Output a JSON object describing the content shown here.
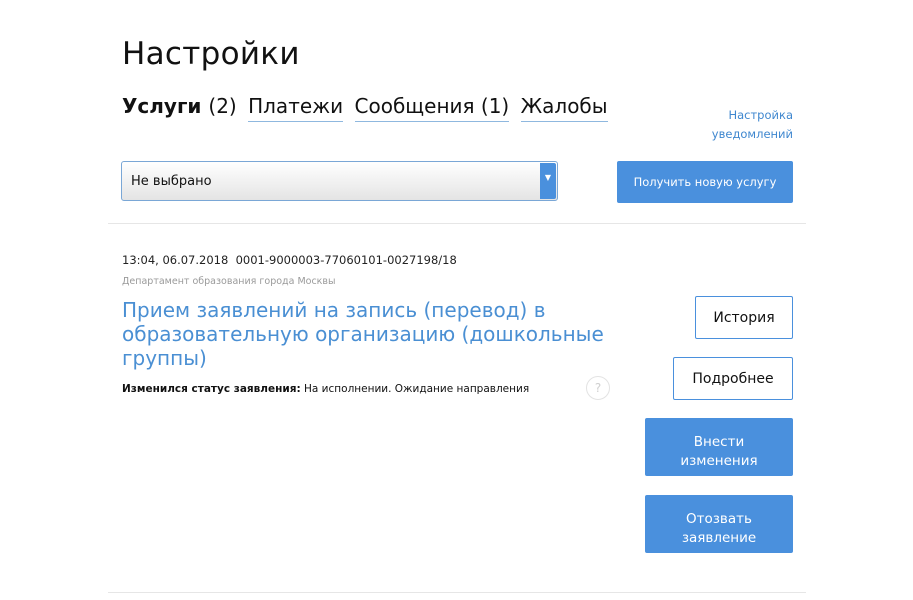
{
  "header": {
    "title": "Настройки"
  },
  "tabs": [
    {
      "label": "Услуги",
      "count": "(2)"
    },
    {
      "label": "Платежи"
    },
    {
      "label": "Сообщения (1)"
    },
    {
      "label": "Жалобы"
    }
  ],
  "notifications_link": {
    "line1": "Настройка",
    "line2": "уведомлений"
  },
  "filter": {
    "selected": "Не выбрано"
  },
  "new_service_button": "Получить новую услугу",
  "service": {
    "timestamp": "13:04, 06.07.2018",
    "number": "0001-9000003-77060101-0027198/18",
    "department": "Департамент образования города Москвы",
    "title": "Прием заявлений на запись (перевод) в образовательную организацию (дошкольные группы)",
    "status_label": "Изменился статус заявления:",
    "status_value": "На исполнении. Ожидание направления",
    "help": "?",
    "actions": {
      "history": "История",
      "details": "Подробнее",
      "change_line1": "Внести",
      "change_line2": "изменения",
      "revoke_line1": "Отозвать",
      "revoke_line2": "заявление"
    }
  },
  "colors": {
    "accent": "#4a90dd",
    "link": "#4a8fd3",
    "muted": "#9a9a9a"
  },
  "icons": {
    "select_arrow": "chevron-down-icon",
    "help": "question-circle-icon"
  }
}
